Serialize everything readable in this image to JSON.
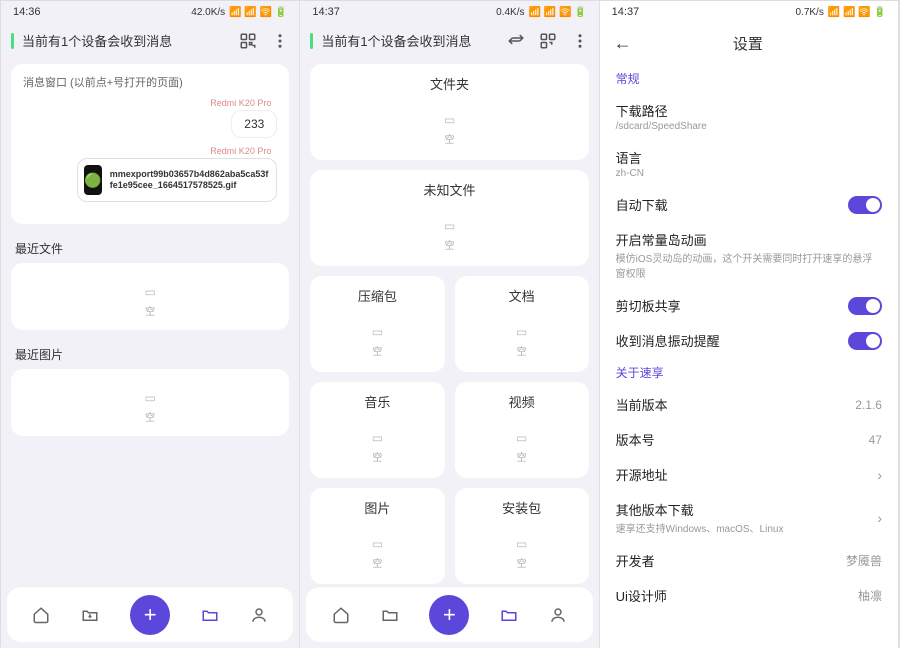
{
  "panel1": {
    "status": {
      "time": "14:36",
      "speed": "42.0K/s"
    },
    "header_title": "当前有1个设备会收到消息",
    "msg_window_label": "消息窗口 (以前点+号打开的页面)",
    "device1": "Redmi K20 Pro",
    "bubble1": "233",
    "device2": "Redmi K20 Pro",
    "filename": "mmexport99b03657b4d862aba5ca53ffe1e95cee_1664517578525.gif",
    "recent_files_label": "最近文件",
    "recent_images_label": "最近图片",
    "empty": "空"
  },
  "panel2": {
    "status": {
      "time": "14:37",
      "speed": "0.4K/s"
    },
    "header_title": "当前有1个设备会收到消息",
    "categories": {
      "folder": "文件夹",
      "unknown": "未知文件",
      "archive": "压缩包",
      "doc": "文档",
      "music": "音乐",
      "video": "视频",
      "image": "图片",
      "apk": "安装包"
    },
    "empty": "空"
  },
  "panel3": {
    "status": {
      "time": "14:37",
      "speed": "0.7K/s"
    },
    "settings_title": "设置",
    "section_general": "常规",
    "download_path": {
      "label": "下载路径",
      "value": "/sdcard/SpeedShare"
    },
    "language": {
      "label": "语言",
      "value": "zh-CN"
    },
    "auto_download": "自动下载",
    "dynamic_island": {
      "label": "开启常量岛动画",
      "sub": "模仿iOS灵动岛的动画，这个开关需要同时打开速享的悬浮窗权限"
    },
    "clipboard_share": "剪切板共享",
    "vibrate": "收到消息振动提醒",
    "section_about": "关于速享",
    "version": {
      "label": "当前版本",
      "value": "2.1.6"
    },
    "build": {
      "label": "版本号",
      "value": "47"
    },
    "opensource": "开源地址",
    "other_download": {
      "label": "其他版本下载",
      "sub": "速享还支持Windows、macOS、Linux"
    },
    "developer": {
      "label": "开发者",
      "value": "梦魇兽"
    },
    "designer": {
      "label": "Ui设计师",
      "value": "柚凛"
    }
  }
}
